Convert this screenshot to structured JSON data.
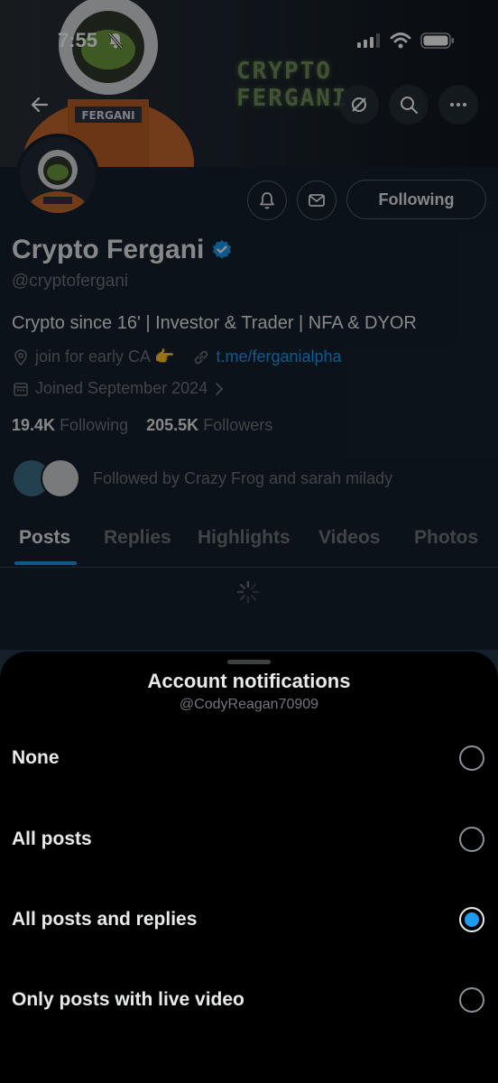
{
  "status_bar": {
    "time": "7:55"
  },
  "banner": {
    "text_line1": "CRYPTO",
    "text_line2": "FERGANI"
  },
  "profile": {
    "name": "Crypto Fergani",
    "handle": "@cryptofergani",
    "bio": "Crypto since 16' | Investor & Trader | NFA & DYOR",
    "location": "join for early CA 👉",
    "link": "t.me/ferganialpha",
    "joined": "Joined September 2024",
    "following_count": "19.4K",
    "following_label": "Following",
    "followers_count": "205.5K",
    "followers_label": "Followers",
    "followed_by": "Followed by Crazy Frog and sarah milady",
    "following_button": "Following"
  },
  "tabs": [
    "Posts",
    "Replies",
    "Highlights",
    "Videos",
    "Photos"
  ],
  "sheet": {
    "title": "Account notifications",
    "subtitle": "@CodyReagan70909",
    "options": [
      {
        "label": "None",
        "selected": false
      },
      {
        "label": "All posts",
        "selected": false
      },
      {
        "label": "All posts and replies",
        "selected": true
      },
      {
        "label": "Only posts with live video",
        "selected": false
      }
    ]
  },
  "colors": {
    "accent": "#1d9bf0",
    "background": "#15202b",
    "sheet": "#000000"
  }
}
